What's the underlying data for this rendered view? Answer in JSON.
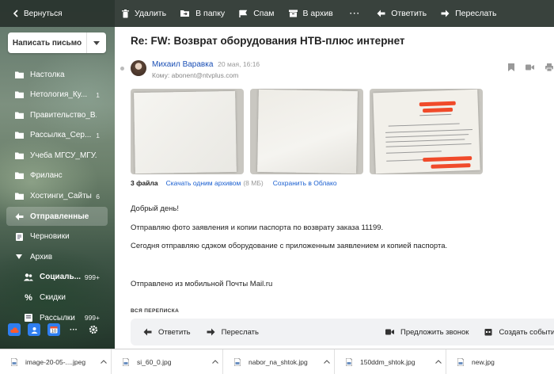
{
  "toolbar": {
    "back_label": "Вернуться",
    "delete_label": "Удалить",
    "to_folder_label": "В папку",
    "spam_label": "Спам",
    "archive_label": "В архив",
    "reply_label": "Ответить",
    "forward_label": "Переслать"
  },
  "compose": {
    "label": "Написать письмо"
  },
  "folders": [
    {
      "label": "Настолка",
      "count": ""
    },
    {
      "label": "Нетология_Ку...",
      "count": "1"
    },
    {
      "label": "Правительство_В...",
      "count": ""
    },
    {
      "label": "Рассылка_Сер...",
      "count": "1"
    },
    {
      "label": "Учеба МГСУ_МГУ...",
      "count": ""
    },
    {
      "label": "Фриланс",
      "count": ""
    },
    {
      "label": "Хостинги_Сайты",
      "count": "6"
    },
    {
      "label": "Отправленные",
      "count": ""
    },
    {
      "label": "Черновики",
      "count": ""
    },
    {
      "label": "Архив",
      "count": ""
    },
    {
      "label": "Социаль...",
      "count": "999+"
    },
    {
      "label": "Скидки",
      "count": ""
    },
    {
      "label": "Рассылки",
      "count": "999+"
    }
  ],
  "message": {
    "subject": "Re: FW: Возврат оборудования НТВ-плюс интернет",
    "sender": "Михаил Варавка",
    "date": "20 мая, 16:16",
    "to": "Кому: abonent@ntvplus.com"
  },
  "attachments": {
    "count_label": "3 файла",
    "download_all": "Скачать одним архивом",
    "size": "(8 МБ)",
    "save_cloud": "Сохранить в Облако"
  },
  "body": {
    "greeting": "Добрый день!",
    "line1": "Отправляю фото заявления и копии паспорта по возврату заказа 11199.",
    "line2": "Сегодня отправляю сдэком оборудование с приложенным заявлением и копией паспорта.",
    "signature": "Отправлено из мобильной Почты Mail.ru"
  },
  "thread": {
    "label": "ВСЯ ПЕРЕПИСКА",
    "reply": "Ответить",
    "forward": "Переслать",
    "call": "Предложить звонок",
    "event": "Создать событие"
  },
  "downloads": [
    {
      "name": "image-20-05-....jpeg"
    },
    {
      "name": "si_60_0.jpg"
    },
    {
      "name": "nabor_na_shtok.jpg"
    },
    {
      "name": "150ddm_shtok.jpg"
    },
    {
      "name": "new.jpg"
    }
  ],
  "colors": {
    "accent": "#1a5fd0",
    "sender": "#1a4fb5",
    "redact": "#f04a2a"
  }
}
